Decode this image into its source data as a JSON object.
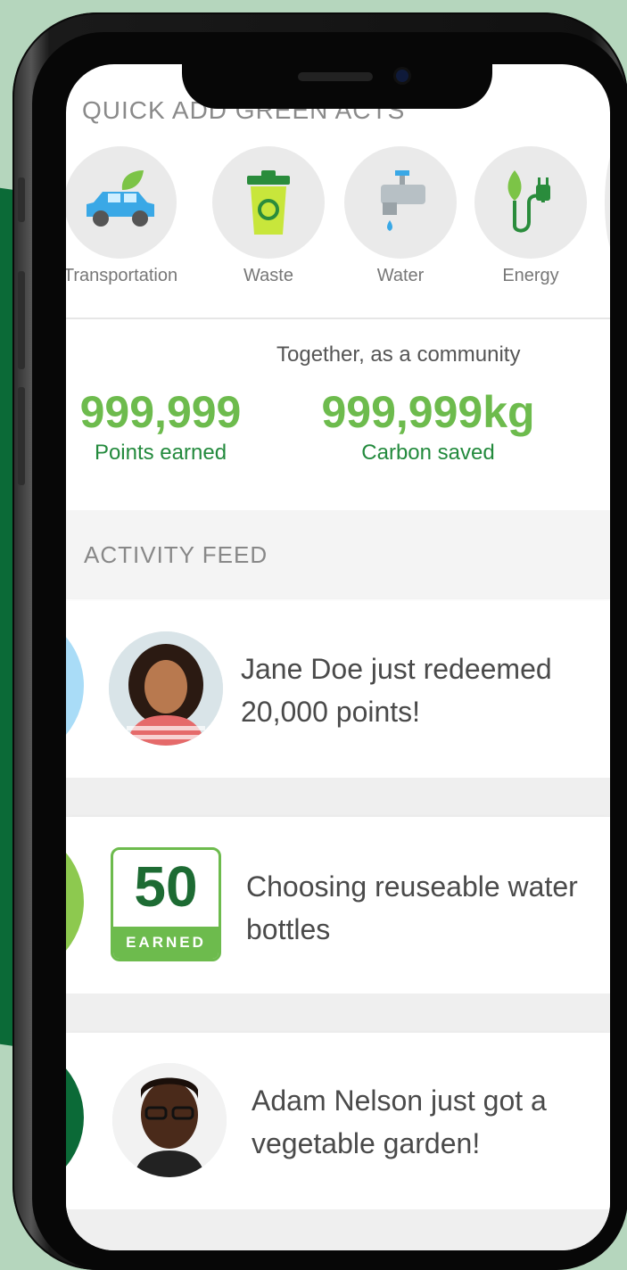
{
  "quick_add": {
    "title": "QUICK ADD GREEN ACTS",
    "items": [
      {
        "label": "Transportation",
        "icon": "car-icon"
      },
      {
        "label": "Waste",
        "icon": "recycle-bin-icon"
      },
      {
        "label": "Water",
        "icon": "faucet-icon"
      },
      {
        "label": "Energy",
        "icon": "plug-icon"
      }
    ]
  },
  "community": {
    "heading": "Together, as a community",
    "stats": [
      {
        "value": "999,999",
        "label": "Points earned"
      },
      {
        "value": "999,999kg",
        "label": "Carbon saved"
      }
    ]
  },
  "feed": {
    "title": "ACTIVITY FEED",
    "items": [
      {
        "line1": "Jane Doe just redeemed",
        "line2": "20,000 points!"
      },
      {
        "badge_value": "50",
        "badge_label": "EARNED",
        "line1": "Choosing reuseable water",
        "line2": "bottles"
      },
      {
        "line1": "Adam Nelson just got a",
        "line2": "vegetable garden!"
      }
    ]
  },
  "colors": {
    "accent_green": "#6dbb4d",
    "dark_green": "#1d6b33",
    "background": "#b5d6bd"
  }
}
